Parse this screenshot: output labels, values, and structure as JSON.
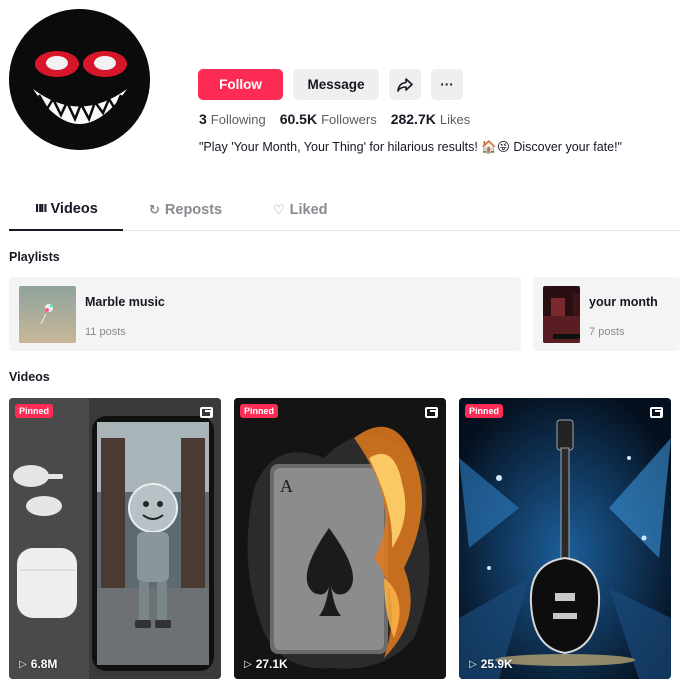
{
  "profile": {
    "follow_label": "Follow",
    "message_label": "Message",
    "share_icon": "share-arrow-icon",
    "more_label": "···",
    "stats": {
      "following_count": "3",
      "following_label": "Following",
      "followers_count": "60.5K",
      "followers_label": "Followers",
      "likes_count": "282.7K",
      "likes_label": "Likes"
    },
    "bio": "\"Play 'Your Month, Your Thing' for hilarious results! 🏠😜 Discover your fate!\"",
    "accent_color": "#fe2c55"
  },
  "tabs": [
    {
      "icon": "grid-icon",
      "glyph": "ⅡⅡ",
      "label": "Videos",
      "active": true
    },
    {
      "icon": "repost-icon",
      "glyph": "↻",
      "label": "Reposts",
      "active": false
    },
    {
      "icon": "heart-outline-icon",
      "glyph": "♡",
      "label": "Liked",
      "active": false
    }
  ],
  "playlists": {
    "heading": "Playlists",
    "items": [
      {
        "title": "Marble music",
        "count": "11 posts"
      },
      {
        "title": "your month",
        "count": "7 posts"
      }
    ]
  },
  "videos": {
    "heading": "Videos",
    "items": [
      {
        "badge": "Pinned",
        "views": "6.8M"
      },
      {
        "badge": "Pinned",
        "views": "27.1K"
      },
      {
        "badge": "Pinned",
        "views": "25.9K"
      }
    ]
  }
}
